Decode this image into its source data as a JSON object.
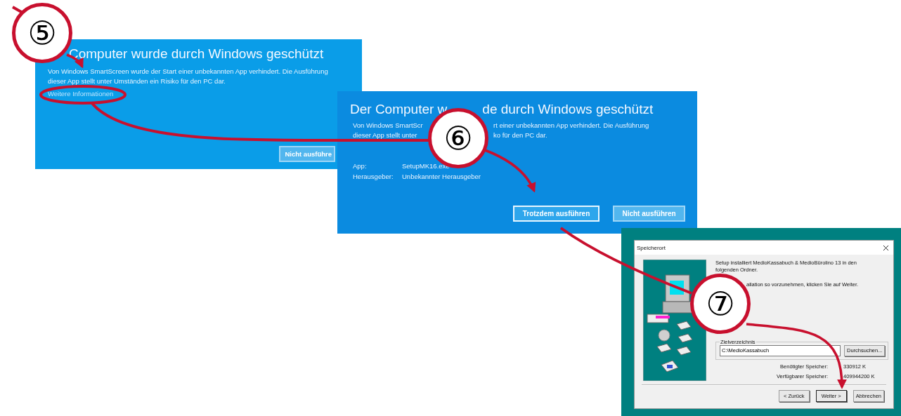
{
  "steps": [
    {
      "label": "⑤"
    },
    {
      "label": "⑥"
    },
    {
      "label": "⑦"
    }
  ],
  "smartscreen_collapsed": {
    "title": "Computer wurde durch Windows geschützt",
    "message_lines": [
      "Von Windows SmartScreen wurde der Start einer unbekannten App verhindert. Die Ausführung",
      "dieser App stellt unter Umständen ein Risiko für den PC dar."
    ],
    "link": "Weitere Informationen",
    "button": "Nicht ausführe"
  },
  "smartscreen_expanded": {
    "title_parts": [
      "Der Computer w",
      "de durch Windows geschützt"
    ],
    "message_lines": [
      [
        "Von Windows SmartScr",
        "rt einer unbekannten App verhindert. Die Ausführung"
      ],
      [
        "dieser App stellt unter",
        "ko für den PC dar."
      ]
    ],
    "details": [
      {
        "label": "App:",
        "value": "SetupMK16.exe"
      },
      {
        "label": "Herausgeber:",
        "value": "Unbekannter Herausgeber"
      }
    ],
    "buttons": [
      {
        "label": "Trotzdem ausführen",
        "focused": true
      },
      {
        "label": "Nicht ausführen",
        "focused": false
      }
    ]
  },
  "setup_dialog": {
    "title": "Speicherort",
    "intro": "Setup installiert MedioKassabuch & MedioBürolino 13 in den folgenden Ordner.",
    "instruction": "allation so vorzunehmen, klicken Sie auf Weiter.",
    "group_label": "Zielverzeichnis",
    "path": "C:\\MedioKassabuch",
    "browse_button": "Durchsuchen...",
    "storage": [
      {
        "label": "Benötigter Speicher:",
        "value": "330912 K"
      },
      {
        "label": "Verfügbarer Speicher:",
        "value": "409944200 K"
      }
    ],
    "buttons": [
      {
        "label": "< Zurück",
        "focused": false
      },
      {
        "label": "Weiter >",
        "focused": true
      },
      {
        "label": "Abbrechen",
        "focused": false
      }
    ]
  }
}
